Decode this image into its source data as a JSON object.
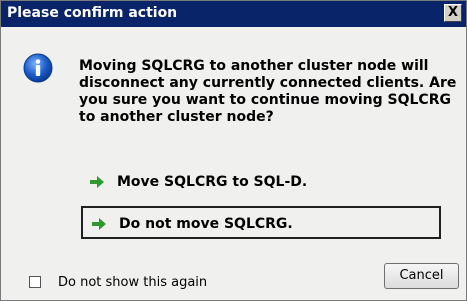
{
  "window": {
    "title": "Please confirm action",
    "close_glyph": "X"
  },
  "dialog": {
    "message": "Moving SQLCRG to another cluster node will disconnect any currently connected clients.  Are you sure you want to continue moving SQLCRG to another cluster node?",
    "icon": "info-icon"
  },
  "options": [
    {
      "label": "Move SQLCRG to SQL-D.",
      "icon": "green-arrow-icon",
      "focused": false
    },
    {
      "label": "Do not move SQLCRG.",
      "icon": "green-arrow-icon",
      "focused": true
    }
  ],
  "footer": {
    "checkbox_label": "Do not show this again",
    "checkbox_checked": false,
    "cancel_label": "Cancel"
  },
  "colors": {
    "titlebar": "#0a246a",
    "arrow": "#2e9a2e",
    "info": "#1d5fc7"
  }
}
